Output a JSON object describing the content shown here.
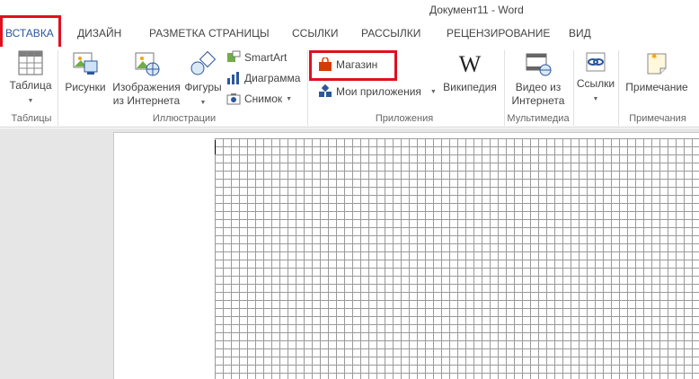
{
  "window": {
    "title": "Документ11 - Word"
  },
  "tabs": [
    {
      "label": "ВСТАВКА",
      "active": true
    },
    {
      "label": "ДИЗАЙН"
    },
    {
      "label": "РАЗМЕТКА СТРАНИЦЫ"
    },
    {
      "label": "ССЫЛКИ"
    },
    {
      "label": "РАССЫЛКИ"
    },
    {
      "label": "РЕЦЕНЗИРОВАНИЕ"
    },
    {
      "label": "ВИД"
    }
  ],
  "ribbon": {
    "tables": {
      "group_label": "Таблицы",
      "table_button": "Таблица"
    },
    "illustrations": {
      "group_label": "Иллюстрации",
      "pictures_button": "Рисунки",
      "online_pictures_line1": "Изображения",
      "online_pictures_line2": "из Интернета",
      "shapes_button": "Фигуры",
      "smartart_button": "SmartArt",
      "chart_button": "Диаграмма",
      "screenshot_button": "Снимок"
    },
    "apps": {
      "group_label": "Приложения",
      "store_button": "Магазин",
      "my_apps_button": "Мои приложения",
      "wikipedia_button": "Википедия"
    },
    "media": {
      "group_label": "Мультимедиа",
      "online_video_line1": "Видео из",
      "online_video_line2": "Интернета"
    },
    "links": {
      "links_button": "Ссылки"
    },
    "comments": {
      "group_label": "Примечания",
      "comment_button": "Примечание"
    }
  },
  "colors": {
    "accent": "#2b579a",
    "highlight": "#e0101e",
    "office_orange": "#d83b01"
  }
}
